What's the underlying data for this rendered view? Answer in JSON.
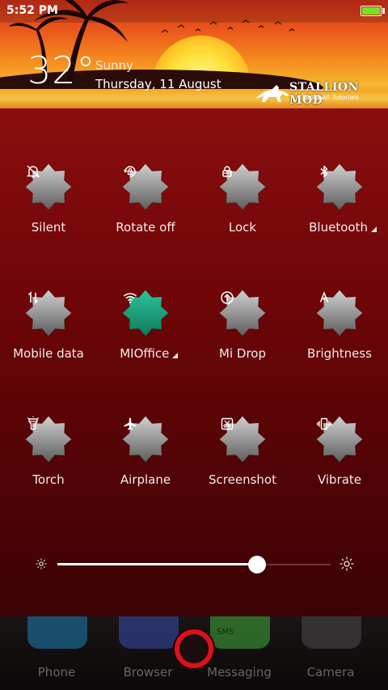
{
  "status_bar": {
    "time": "5:52 PM",
    "battery_icon": "battery-full-icon",
    "battery_color": "#76e321"
  },
  "weather": {
    "temperature": "32°",
    "condition": "Sunny",
    "date": "Thursday, 11 August"
  },
  "watermark": {
    "title": "STALLION MOD",
    "subtitle": "Droid All Tutorials"
  },
  "toggles": [
    {
      "label": "Silent",
      "icon": "bell-off-icon",
      "active": false
    },
    {
      "label": "Rotate off",
      "icon": "rotate-lock-icon",
      "active": false
    },
    {
      "label": "Lock",
      "icon": "lock-icon",
      "active": false
    },
    {
      "label": "Bluetooth",
      "icon": "bluetooth-icon",
      "active": false,
      "has_menu": true
    },
    {
      "label": "Mobile data",
      "icon": "mobile-data-icon",
      "active": false
    },
    {
      "label": "MIOffice",
      "icon": "wifi-icon",
      "active": true,
      "has_menu": true
    },
    {
      "label": "Mi Drop",
      "icon": "mi-drop-icon",
      "active": false
    },
    {
      "label": "Brightness",
      "icon": "auto-brightness-icon",
      "active": false
    },
    {
      "label": "Torch",
      "icon": "torch-icon",
      "active": false
    },
    {
      "label": "Airplane",
      "icon": "airplane-icon",
      "active": false
    },
    {
      "label": "Screenshot",
      "icon": "screenshot-icon",
      "active": false
    },
    {
      "label": "Vibrate",
      "icon": "vibrate-icon",
      "active": false
    }
  ],
  "brightness": {
    "level": 0.73,
    "low_icon": "brightness-low-icon",
    "high_icon": "brightness-high-icon"
  },
  "dock": [
    {
      "label": "Phone",
      "icon": "phone-icon"
    },
    {
      "label": "Browser",
      "icon": "browser-icon"
    },
    {
      "label": "Messaging",
      "icon": "messaging-icon",
      "icon_text": "SMS"
    },
    {
      "label": "Camera",
      "icon": "camera-icon"
    }
  ],
  "colors": {
    "active_tile": "#1a9b7a",
    "inactive_tile": "#8f8f8f",
    "panel": "#700608"
  }
}
